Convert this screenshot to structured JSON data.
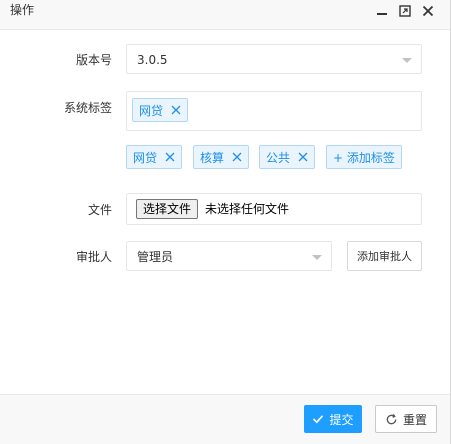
{
  "dialog": {
    "title": "操作"
  },
  "window_controls": {
    "minimize_icon": "minimize-icon",
    "maximize_icon": "maximize-icon",
    "close_icon": "close-icon"
  },
  "form": {
    "version": {
      "label": "版本号",
      "value": "3.0.5"
    },
    "system_tags": {
      "label": "系统标签",
      "selected": [
        "网贷"
      ],
      "options": [
        "网贷",
        "核算",
        "公共"
      ],
      "add_label": "+ 添加标签"
    },
    "file": {
      "label": "文件",
      "button_label": "选择文件",
      "status_text": "未选择任何文件"
    },
    "approver": {
      "label": "审批人",
      "value": "管理员",
      "add_button_label": "添加审批人"
    }
  },
  "footer": {
    "submit_label": "提交",
    "reset_label": "重置"
  },
  "colors": {
    "primary": "#1e9fff",
    "tag_text": "#1e90e8",
    "tag_bg": "#eaf4fd",
    "tag_border": "#b3d8f7"
  }
}
